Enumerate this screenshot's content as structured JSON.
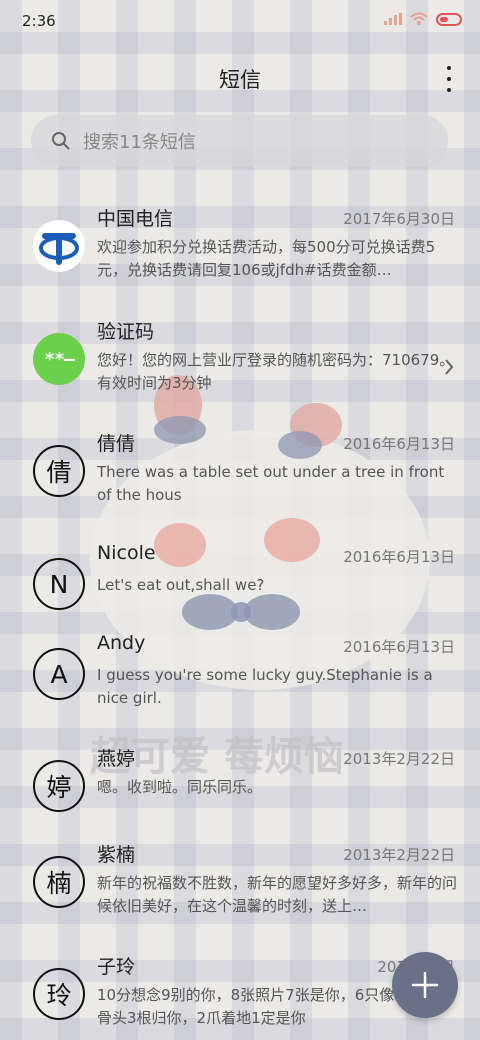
{
  "status": {
    "time": "2:36"
  },
  "header": {
    "title": "短信"
  },
  "search": {
    "placeholder": "搜索11条短信"
  },
  "wallpaper_text": "超可爱 莓烦恼",
  "messages": [
    {
      "sender": "中国电信",
      "date": "2017年6月30日",
      "preview": "欢迎参加积分兑换话费活动，每500分可兑换话费5元，兑换话费请回复106或jfdh#话费金额…",
      "avatar": "china-telecom-logo"
    },
    {
      "sender": "验证码",
      "date": "",
      "preview": "您好！您的网上营业厅登录的随机密码为：710679。有效时间为3分钟",
      "avatar_text": "**–"
    },
    {
      "sender": "倩倩",
      "date": "2016年6月13日",
      "preview": "There was a table set out under a tree in front of the hous",
      "avatar_text": "倩"
    },
    {
      "sender": "Nicole",
      "date": "2016年6月13日",
      "preview": "Let's eat out,shall we?",
      "avatar_text": "N"
    },
    {
      "sender": "Andy",
      "date": "2016年6月13日",
      "preview": "I guess you're some lucky guy.Stephanie is a nice girl.",
      "avatar_text": "A"
    },
    {
      "sender": "燕婷",
      "date": "2013年2月22日",
      "preview": "嗯。收到啦。同乐同乐。",
      "avatar_text": "婷"
    },
    {
      "sender": "紫楠",
      "date": "2013年2月22日",
      "preview": "新年的祝福数不胜数，新年的愿望好多好多，新年的问候依旧美好，在这个温馨的时刻，送上…",
      "avatar_text": "楠"
    },
    {
      "sender": "子玲",
      "date": "2013年2月",
      "preview": "10分想念9别的你，8张照片7张是你，6只像你，4根骨头3根归你，2爪着地1定是你",
      "avatar_text": "玲"
    }
  ],
  "colors": {
    "accent_green": "#6ad14b",
    "fab": "#6a7088",
    "battery": "#e15656",
    "telecom_blue": "#1a5eb8"
  }
}
